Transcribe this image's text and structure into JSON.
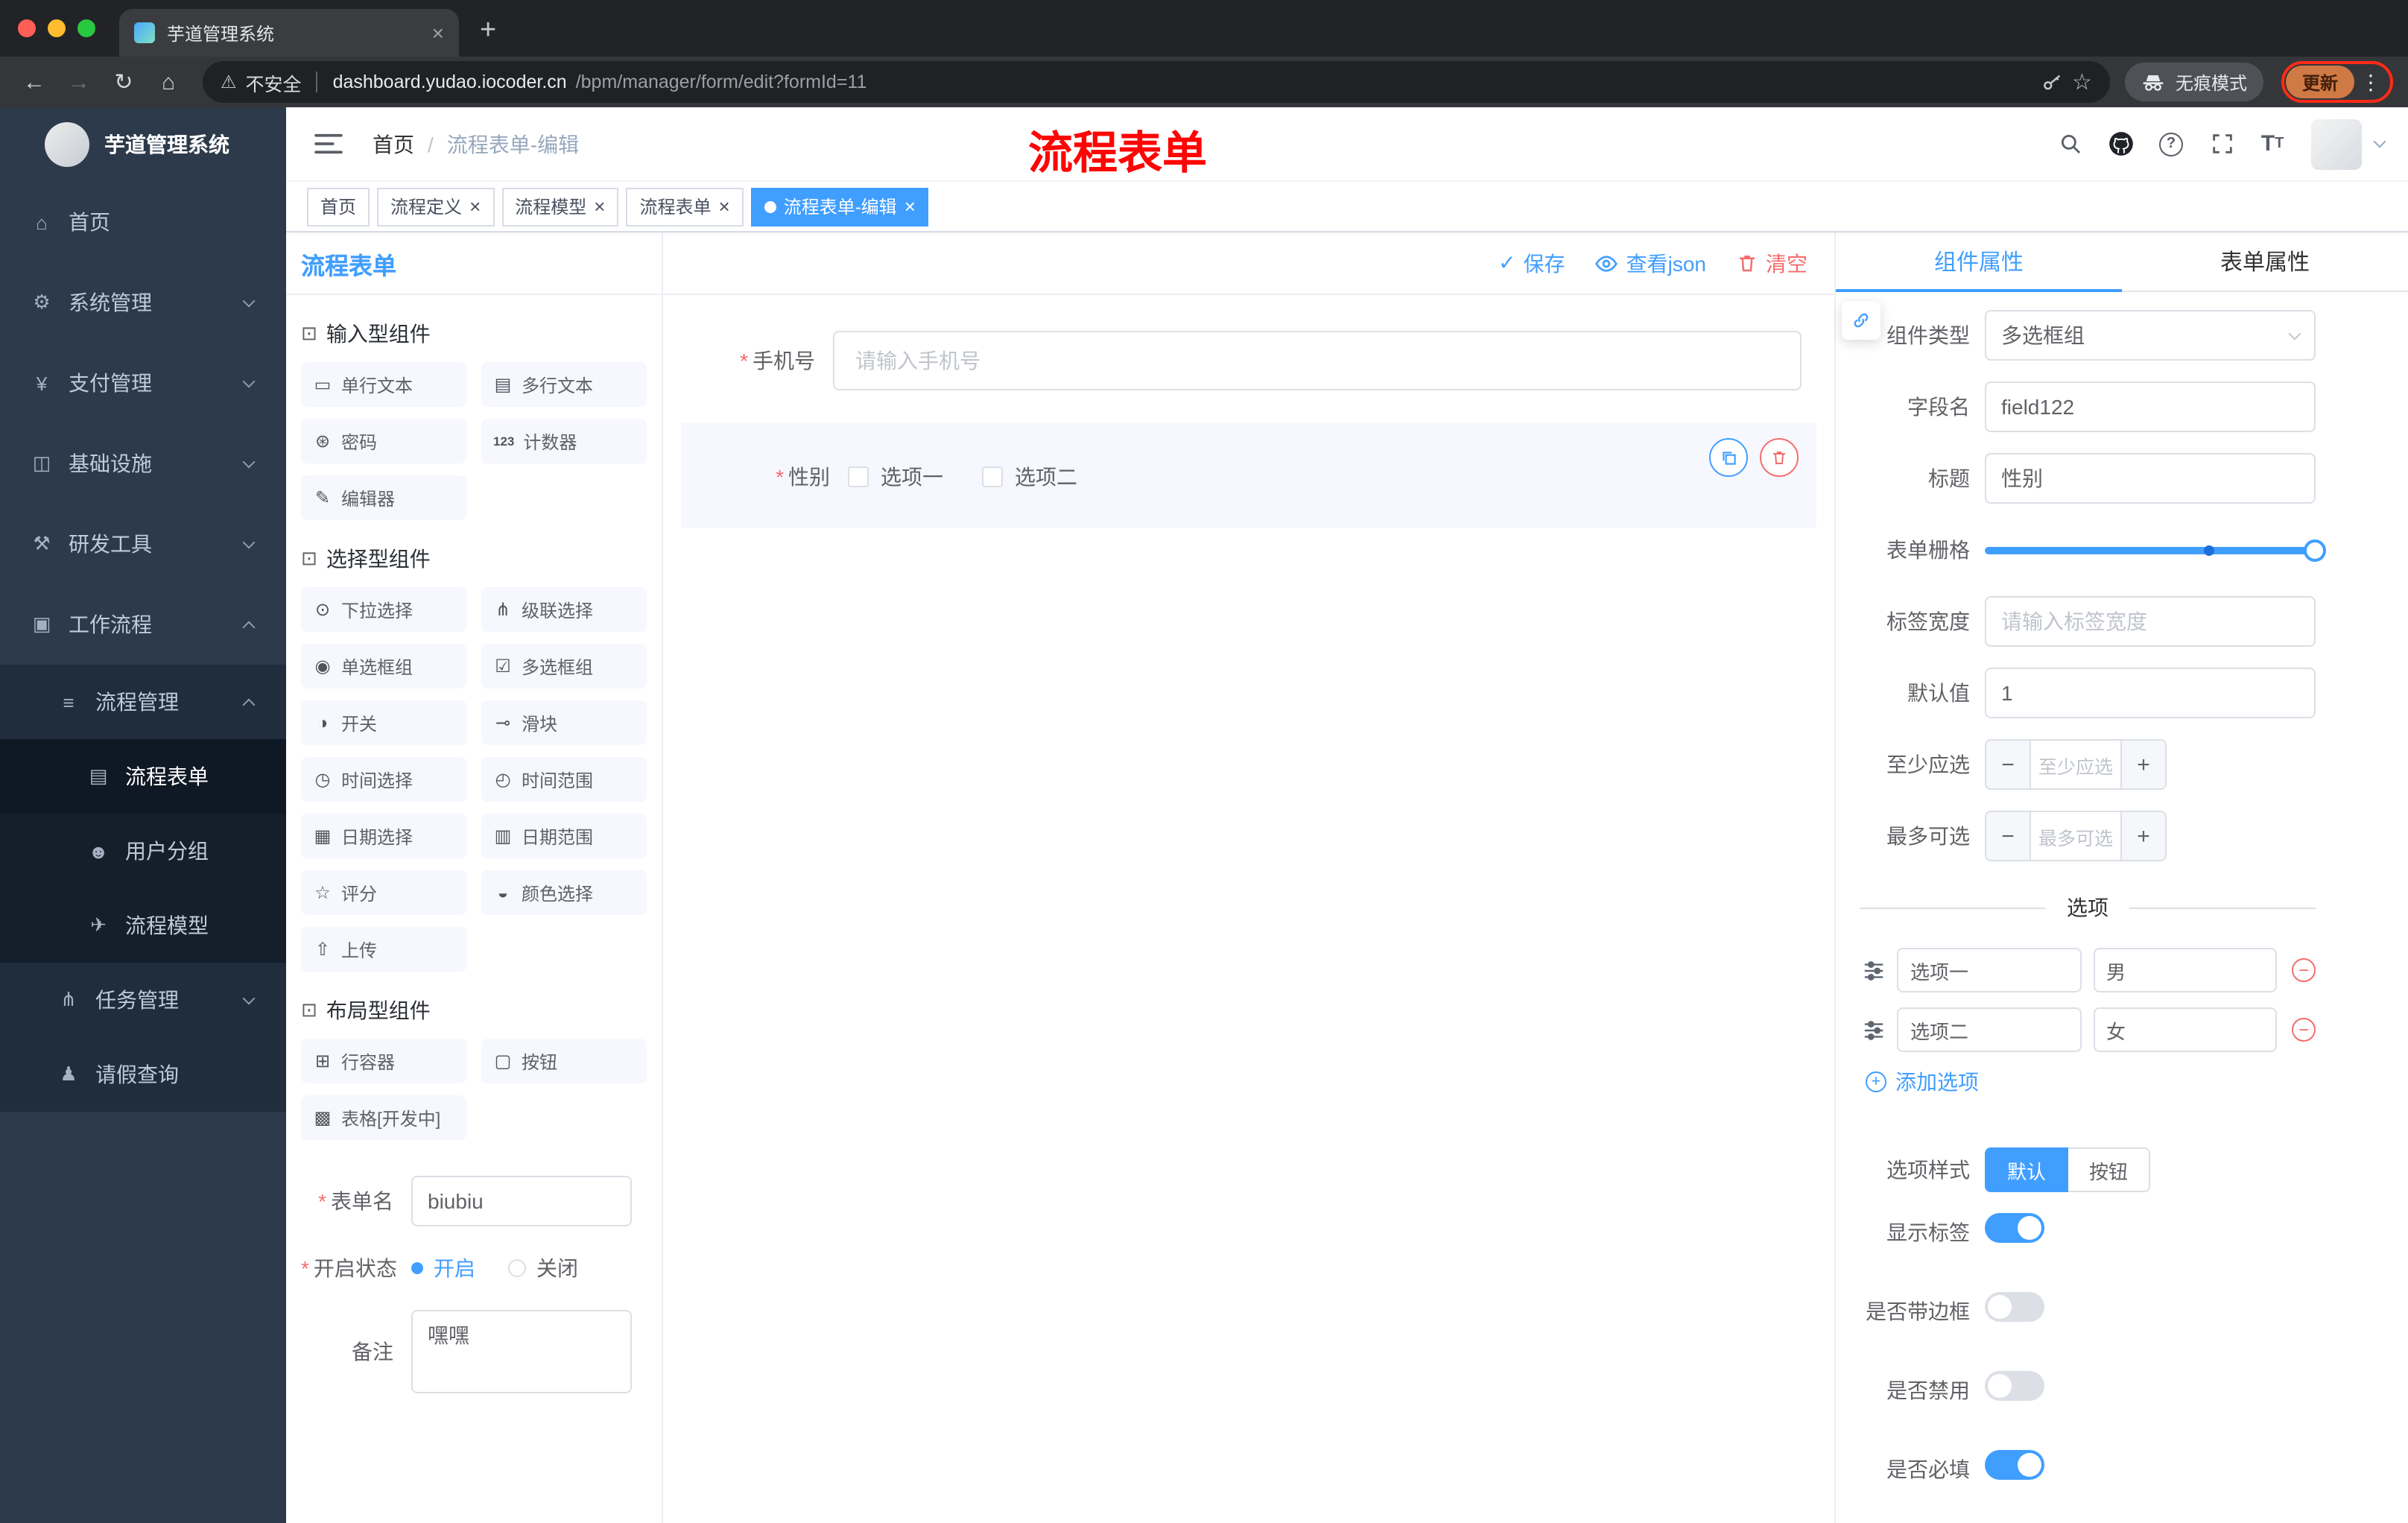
{
  "browser": {
    "tab_title": "芋道管理系统",
    "security_label": "不安全",
    "url_domain": "dashboard.yudao.iocoder.cn",
    "url_path": "/bpm/manager/form/edit?formId=11",
    "incognito_label": "无痕模式",
    "update_label": "更新"
  },
  "sidebar": {
    "logo_title": "芋道管理系统",
    "items": [
      {
        "id": "home",
        "label": "首页",
        "glyph": "⌂",
        "icon": "home-icon",
        "level": 1
      },
      {
        "id": "system",
        "label": "系统管理",
        "glyph": "⚙",
        "icon": "gear-icon",
        "level": 1,
        "chevron": "down"
      },
      {
        "id": "payment",
        "label": "支付管理",
        "glyph": "¥",
        "icon": "yen-icon",
        "level": 1,
        "chevron": "down"
      },
      {
        "id": "infra",
        "label": "基础设施",
        "glyph": "◫",
        "icon": "monitor-icon",
        "level": 1,
        "chevron": "down"
      },
      {
        "id": "devtools",
        "label": "研发工具",
        "glyph": "⚒",
        "icon": "tools-icon",
        "level": 1,
        "chevron": "down"
      },
      {
        "id": "workflow",
        "label": "工作流程",
        "glyph": "▣",
        "icon": "briefcase-icon",
        "level": 1,
        "chevron": "up"
      },
      {
        "id": "process-mgmt",
        "label": "流程管理",
        "glyph": "≡",
        "icon": "list-icon",
        "level": 2,
        "chevron": "up"
      },
      {
        "id": "process-form",
        "label": "流程表单",
        "glyph": "▤",
        "icon": "document-icon",
        "level": 3,
        "active": true
      },
      {
        "id": "user-group",
        "label": "用户分组",
        "glyph": "☻",
        "icon": "users-icon",
        "level": 3
      },
      {
        "id": "process-model",
        "label": "流程模型",
        "glyph": "✈",
        "icon": "send-icon",
        "level": 3
      },
      {
        "id": "task-mgmt",
        "label": "任务管理",
        "glyph": "⋔",
        "icon": "branch-icon",
        "level": 2,
        "chevron": "down"
      },
      {
        "id": "leave-query",
        "label": "请假查询",
        "glyph": "♟",
        "icon": "user-icon",
        "level": 2
      }
    ]
  },
  "header": {
    "breadcrumb_home": "首页",
    "breadcrumb_sep": "/",
    "breadcrumb_current": "流程表单-编辑",
    "annotation": "流程表单"
  },
  "tags": [
    {
      "label": "首页",
      "closable": false,
      "active": false
    },
    {
      "label": "流程定义",
      "closable": true,
      "active": false
    },
    {
      "label": "流程模型",
      "closable": true,
      "active": false
    },
    {
      "label": "流程表单",
      "closable": true,
      "active": false
    },
    {
      "label": "流程表单-编辑",
      "closable": true,
      "active": true
    }
  ],
  "designer": {
    "panel_title": "流程表单",
    "toolbar": {
      "save": "保存",
      "view_json": "查看json",
      "clear": "清空"
    },
    "palette": {
      "sections": [
        {
          "title": "输入型组件",
          "icon": "input-components-icon",
          "glyph": "⊡",
          "items": [
            {
              "label": "单行文本",
              "glyph": "▭",
              "icon": "text-input-icon"
            },
            {
              "label": "多行文本",
              "glyph": "▤",
              "icon": "textarea-icon"
            },
            {
              "label": "密码",
              "glyph": "⊛",
              "icon": "password-icon"
            },
            {
              "label": "计数器",
              "glyph": "123",
              "icon": "counter-icon",
              "text_glyph": true
            },
            {
              "label": "编辑器",
              "glyph": "✎",
              "icon": "editor-icon"
            }
          ]
        },
        {
          "title": "选择型组件",
          "icon": "select-components-icon",
          "glyph": "⊡",
          "items": [
            {
              "label": "下拉选择",
              "glyph": "⊙",
              "icon": "dropdown-icon"
            },
            {
              "label": "级联选择",
              "glyph": "⋔",
              "icon": "cascade-icon"
            },
            {
              "label": "单选框组",
              "glyph": "◉",
              "icon": "radio-group-icon"
            },
            {
              "label": "多选框组",
              "glyph": "☑",
              "icon": "checkbox-group-icon"
            },
            {
              "label": "开关",
              "glyph": "◑",
              "icon": "switch-icon"
            },
            {
              "label": "滑块",
              "glyph": "⊸",
              "icon": "slider-icon"
            },
            {
              "label": "时间选择",
              "glyph": "◷",
              "icon": "time-picker-icon"
            },
            {
              "label": "时间范围",
              "glyph": "◴",
              "icon": "time-range-icon"
            },
            {
              "label": "日期选择",
              "glyph": "▦",
              "icon": "date-picker-icon"
            },
            {
              "label": "日期范围",
              "glyph": "▥",
              "icon": "date-range-icon"
            },
            {
              "label": "评分",
              "glyph": "☆",
              "icon": "rate-icon"
            },
            {
              "label": "颜色选择",
              "glyph": "◒",
              "icon": "color-picker-icon"
            },
            {
              "label": "上传",
              "glyph": "⇧",
              "icon": "upload-icon"
            }
          ]
        },
        {
          "title": "布局型组件",
          "icon": "layout-components-icon",
          "glyph": "⊡",
          "items": [
            {
              "label": "行容器",
              "glyph": "⊞",
              "icon": "row-container-icon"
            },
            {
              "label": "按钮",
              "glyph": "▢",
              "icon": "button-icon"
            },
            {
              "label": "表格[开发中]",
              "glyph": "▩",
              "icon": "table-icon"
            }
          ]
        }
      ]
    },
    "meta": {
      "name_label": "表单名",
      "name_value": "biubiu",
      "status_label": "开启状态",
      "status_on": "开启",
      "status_off": "关闭",
      "remark_label": "备注",
      "remark_value": "嘿嘿"
    },
    "canvas": {
      "phone_label": "手机号",
      "phone_placeholder": "请输入手机号",
      "gender_label": "性别",
      "gender_options": [
        "选项一",
        "选项二"
      ]
    },
    "props": {
      "tab_component": "组件属性",
      "tab_form": "表单属性",
      "component_type_label": "组件类型",
      "component_type_value": "多选框组",
      "field_name_label": "字段名",
      "field_name_value": "field122",
      "title_label": "标题",
      "title_value": "性别",
      "grid_label": "表单栅格",
      "label_width_label": "标签宽度",
      "label_width_placeholder": "请输入标签宽度",
      "default_label": "默认值",
      "default_value": "1",
      "min_label": "至少应选",
      "min_placeholder": "至少应选",
      "max_label": "最多可选",
      "max_placeholder": "最多可选",
      "options_divider": "选项",
      "options": [
        {
          "label": "选项一",
          "value": "男"
        },
        {
          "label": "选项二",
          "value": "女"
        }
      ],
      "add_option": "添加选项",
      "style_label": "选项样式",
      "style_default": "默认",
      "style_button": "按钮",
      "show_label": "显示标签",
      "border_label": "是否带边框",
      "disabled_label": "是否禁用",
      "required_label": "是否必填"
    }
  },
  "colors": {
    "primary": "#409EFF",
    "danger": "#F56C6C",
    "annotation": "#FF0000",
    "active_tag": "#409EFF"
  }
}
